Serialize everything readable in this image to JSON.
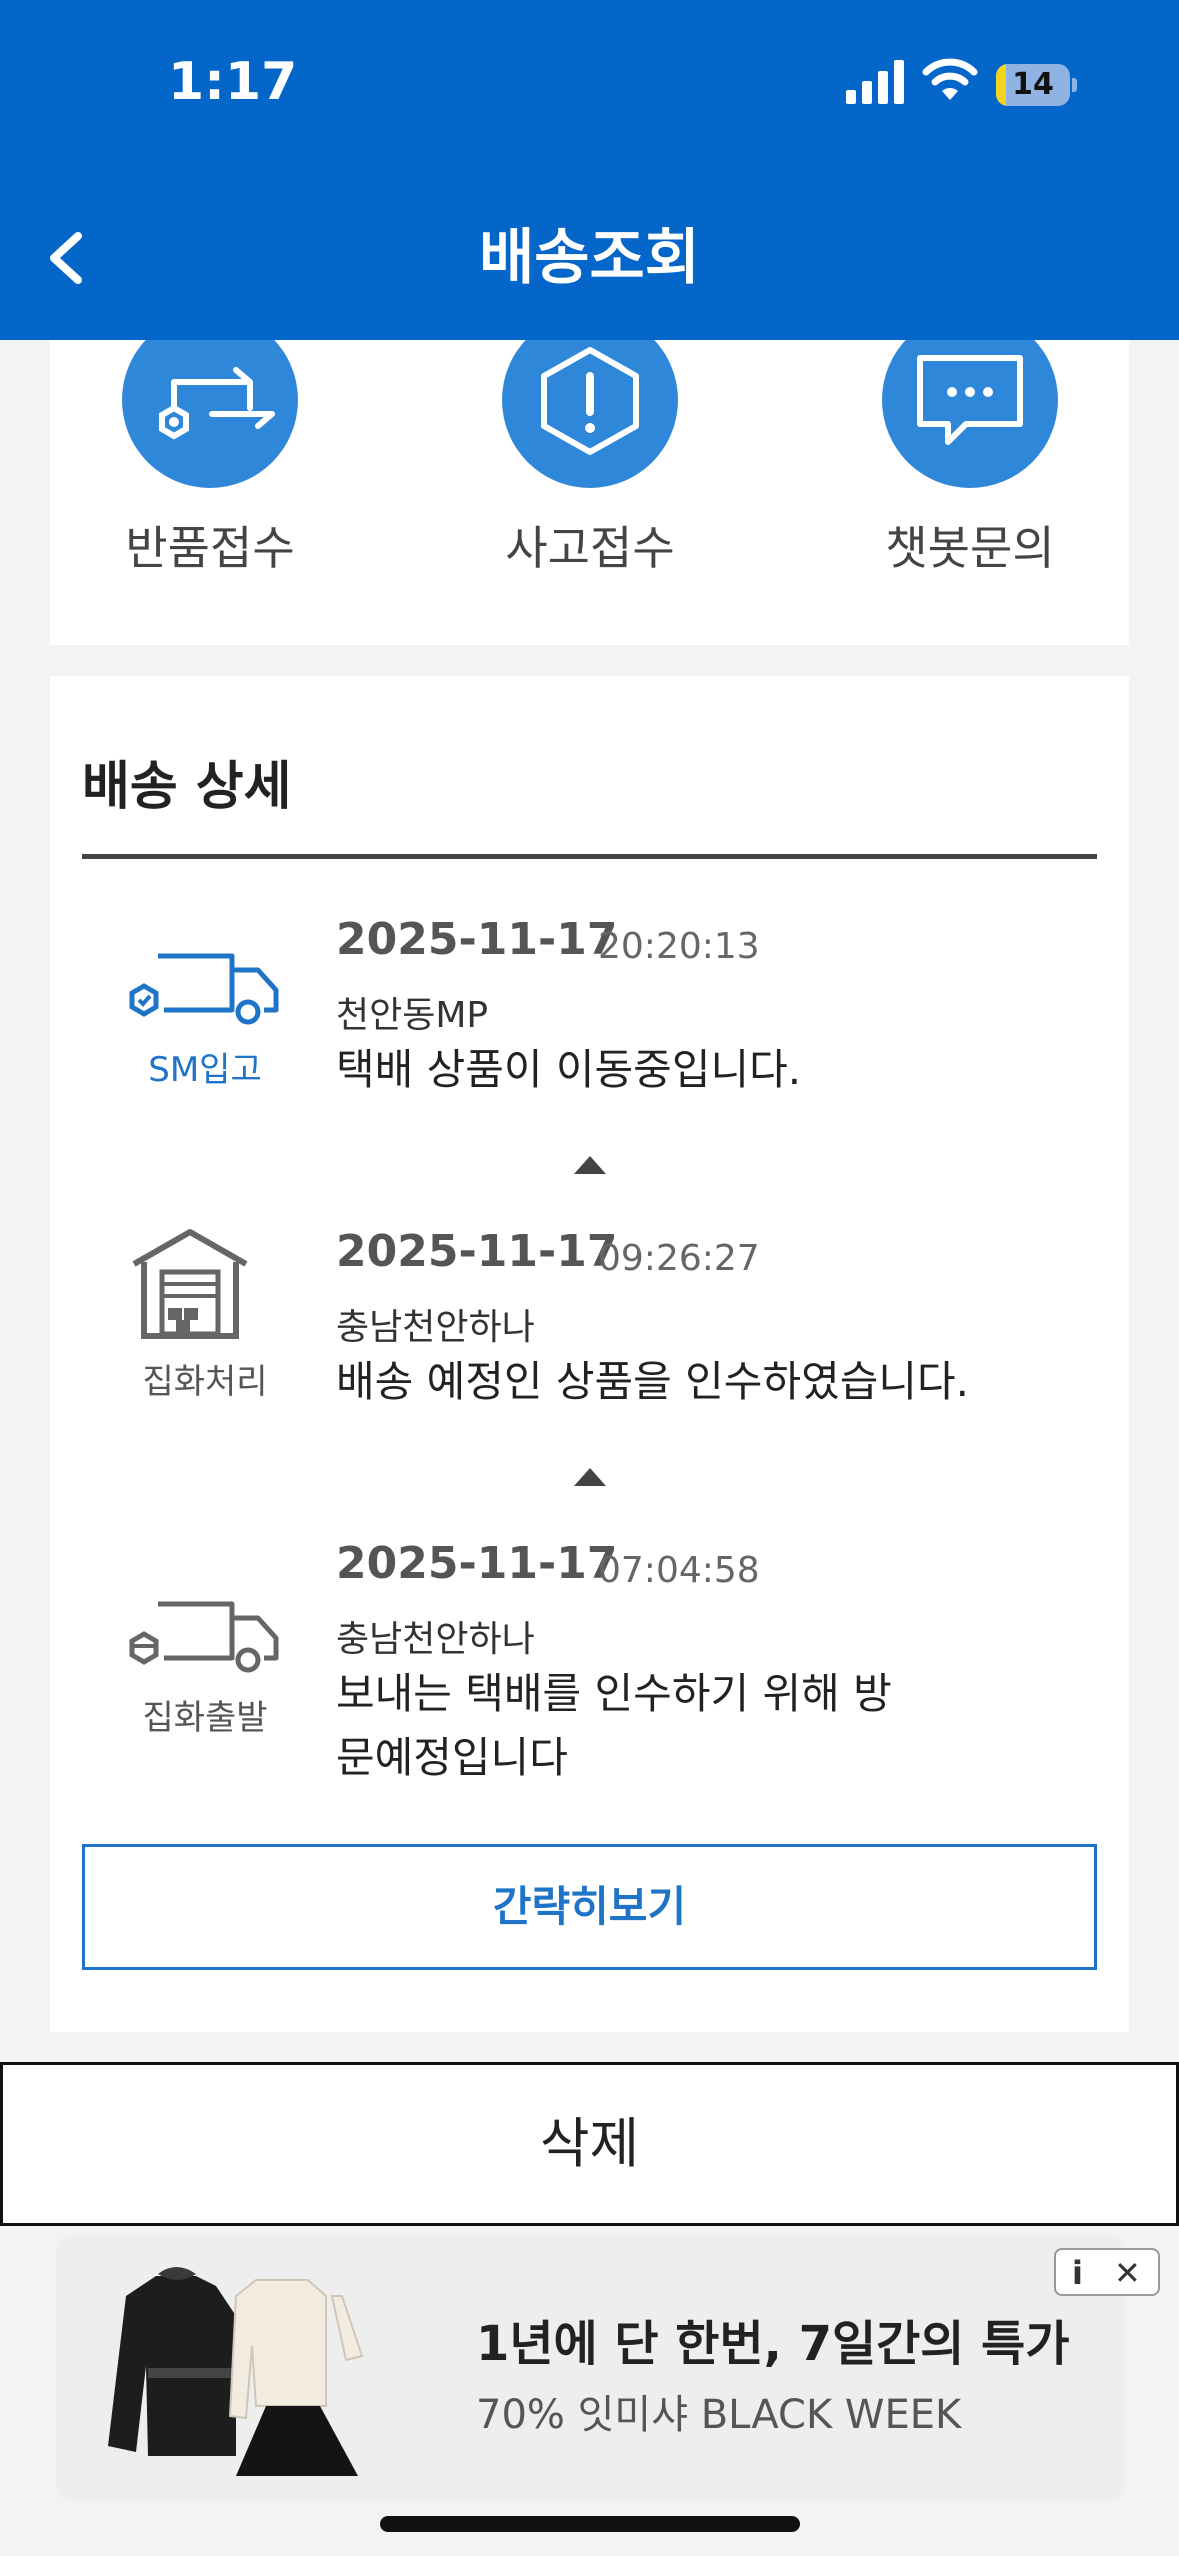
{
  "status_bar": {
    "time": "1:17",
    "battery_level": "14",
    "battery_fraction": 0.14
  },
  "header": {
    "title": "배송조회"
  },
  "actions": [
    {
      "label": "반품접수",
      "icon": "return-icon"
    },
    {
      "label": "사고접수",
      "icon": "alert-icon"
    },
    {
      "label": "챗봇문의",
      "icon": "chat-icon"
    }
  ],
  "detail": {
    "heading": "배송 상세",
    "events": [
      {
        "status": "SM입고",
        "date": "2025-11-17",
        "time": "20:20:13",
        "location": "천안동MP",
        "message": "택배 상품이 이동중입니다."
      },
      {
        "status": "집화처리",
        "date": "2025-11-17",
        "time": "09:26:27",
        "location": "충남천안하나",
        "message": "배송 예정인 상품을 인수하였습니다."
      },
      {
        "status": "집화출발",
        "date": "2025-11-17",
        "time": "07:04:58",
        "location": "충남천안하나",
        "message": "보내는 택배를 인수하기 위해 방문예정입니다"
      }
    ],
    "brief_button": "간략히보기"
  },
  "delete_button": "삭제",
  "ad": {
    "headline": "1년에 단 한번, 7일간의 특가",
    "subtext": "70% 잇미샤 BLACK WEEK",
    "info_label": "i",
    "close_label": "✕"
  },
  "colors": {
    "primary": "#0566c9",
    "accent": "#1f74c8",
    "icon_circle": "#2f87d9"
  }
}
